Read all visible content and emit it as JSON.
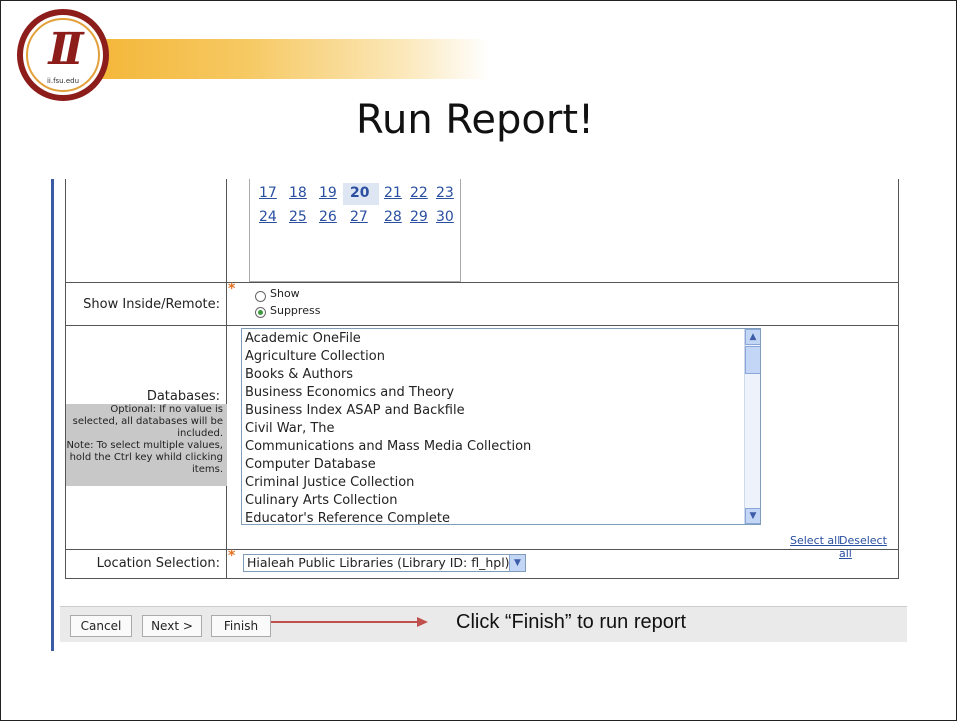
{
  "header": {
    "logo_mark": "II",
    "logo_url": "ii.fsu.edu",
    "title": "Run Report!"
  },
  "calendar": {
    "weeks": [
      [
        "17",
        "18",
        "19",
        "20",
        "21",
        "22",
        "23"
      ],
      [
        "24",
        "25",
        "26",
        "27",
        "28",
        "29",
        "30"
      ]
    ],
    "selected_day": "20"
  },
  "form": {
    "inside_remote": {
      "label": "Show Inside/Remote:",
      "options": [
        "Show",
        "Suppress"
      ],
      "selected": "Suppress"
    },
    "databases": {
      "label": "Databases:",
      "help_lines": [
        "Optional: If no value is",
        "selected, all databases will be",
        "included.",
        "Note: To select multiple values,",
        "hold the Ctrl key whild clicking",
        "items."
      ],
      "items": [
        "Academic OneFile",
        "Agriculture Collection",
        "Books & Authors",
        "Business Economics and Theory",
        "Business Index ASAP and Backfile",
        "Civil War, The",
        "Communications and Mass Media Collection",
        "Computer Database",
        "Criminal Justice Collection",
        "Culinary Arts Collection",
        "Educator's Reference Complete"
      ],
      "select_all": "Select all",
      "deselect_all": "Deselect all"
    },
    "location": {
      "label": "Location Selection:",
      "value": "Hialeah Public Libraries (Library ID: fl_hpl)"
    }
  },
  "buttons": {
    "cancel": "Cancel",
    "next": "Next >",
    "finish": "Finish"
  },
  "callout": "Click “Finish” to run report",
  "colors": {
    "logo_red": "#8c1d1b",
    "gold": "#f3b12c",
    "link_blue": "#2a4fa0",
    "required_star": "#e37222",
    "arrow_red": "#c0504d"
  }
}
